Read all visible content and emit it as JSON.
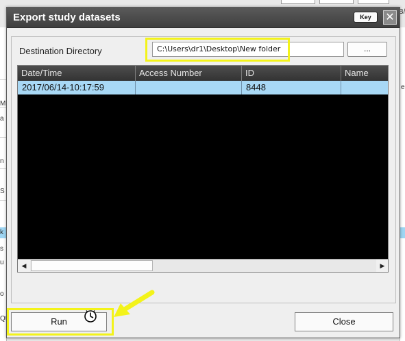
{
  "dialog": {
    "title": "Export study datasets",
    "key_label": "Key",
    "close_glyph": "✕",
    "destination_label": "Destination Directory",
    "destination_value": "C:\\Users\\dr1\\Desktop\\New folder",
    "browse_label": "...",
    "run_label": "Run",
    "close_label": "Close"
  },
  "grid": {
    "columns": [
      "Date/Time",
      "Access Number",
      "ID",
      "Name"
    ],
    "rows": [
      [
        "2017/06/14-10:17:59",
        "",
        "8448",
        ""
      ]
    ],
    "scroll_left": "◀",
    "scroll_right": "▶"
  },
  "background": {
    "left_fragments": [
      "M",
      "a",
      "n",
      "S",
      "k",
      "s",
      "u",
      "o",
      "Qt"
    ],
    "right_fragments": [
      "e",
      "B/"
    ]
  },
  "colors": {
    "highlight": "#f3f31a",
    "selected_row": "#a8d8f5",
    "titlebar": "#4a4a4a"
  },
  "icons": {
    "busy_cursor": "busy-cursor-icon",
    "annotation_arrow": "yellow-arrow-icon"
  }
}
